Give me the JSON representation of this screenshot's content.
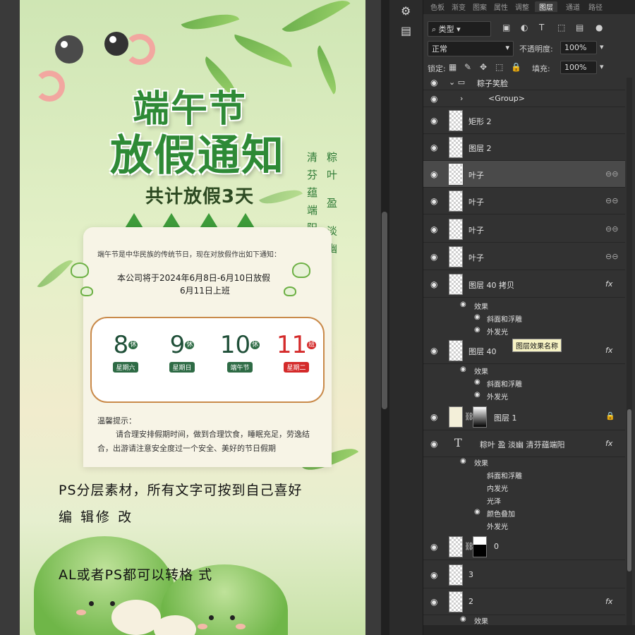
{
  "poster": {
    "title_line1": "端午节",
    "title_line2": "放假通知",
    "subtitle": "共计放假3天",
    "vertical_right": "粽叶 盈 淡幽",
    "vertical_left": "清芬蕴端阳",
    "intro": "端午节是中华民族的传统节日，现在对放假作出如下通知：",
    "notice_line1": "本公司将于2024年6月8日-6月10日放假",
    "notice_line2": "6月11日上班",
    "days": [
      {
        "num": "8",
        "sup": "休",
        "week": "星期六",
        "red": false
      },
      {
        "num": "9",
        "sup": "休",
        "week": "星期日",
        "red": false
      },
      {
        "num": "10",
        "sup": "休",
        "week": "端午节",
        "red": false
      },
      {
        "num": "11",
        "sup": "班",
        "week": "星期二",
        "red": true
      }
    ],
    "tips_title": "温馨提示：",
    "tips_body": "请合理安排假期时间，做到合理饮食，睡眠充足，劳逸结合，出游请注意安全度过一个安全、美好的节日假期",
    "promo1": "PS分层素材，所有文字可按到自己喜好",
    "promo2": "编 辑修 改",
    "promo3": "AL或者PS都可以转格 式"
  },
  "side_icons": [
    "swatch-icon",
    "comment-icon"
  ],
  "panel": {
    "tabs": [
      "色板",
      "渐变",
      "图案",
      "属性",
      "调整",
      "图层",
      "通道",
      "路径"
    ],
    "active_tab": "图层",
    "filter_label": "类型",
    "blend_mode": "正常",
    "opacity_label": "不透明度:",
    "opacity_value": "100%",
    "lock_label": "锁定:",
    "fill_label": "填充:",
    "fill_value": "100%",
    "tooltip": "图层效果名称",
    "layers": [
      {
        "name": "粽子笑脸",
        "kind": "group"
      },
      {
        "name": "<Group>",
        "kind": "subgroup"
      },
      {
        "name": "矩形 2",
        "kind": "layer"
      },
      {
        "name": "图层 2",
        "kind": "layer"
      },
      {
        "name": "叶子",
        "kind": "layer",
        "link": true,
        "selected": true
      },
      {
        "name": "叶子",
        "kind": "layer",
        "link": true
      },
      {
        "name": "叶子",
        "kind": "layer",
        "link": true
      },
      {
        "name": "叶子",
        "kind": "layer",
        "link": true
      },
      {
        "name": "图层 40 拷贝",
        "kind": "layer",
        "fx": true
      },
      {
        "name": "图层 40",
        "kind": "layer",
        "fx": true
      },
      {
        "name": "图层 1",
        "kind": "layer",
        "lock": true
      },
      {
        "name": "粽叶 盈 淡幽 清芬蕴端阳",
        "kind": "text",
        "fx": true
      },
      {
        "name": "0",
        "kind": "layer"
      },
      {
        "name": "3",
        "kind": "layer"
      },
      {
        "name": "2",
        "kind": "layer",
        "fx": true
      }
    ],
    "effects_label": "效果",
    "fx_bevel": "斜面和浮雕",
    "fx_outer_glow": "外发光",
    "fx_inner_glow": "内发光",
    "fx_satin": "光泽",
    "fx_color_overlay": "颜色叠加",
    "fx_symbol": "fx"
  },
  "colors": {
    "accent_green": "#2e8a36",
    "red": "#d42a2a",
    "panel_bg": "#323232"
  }
}
